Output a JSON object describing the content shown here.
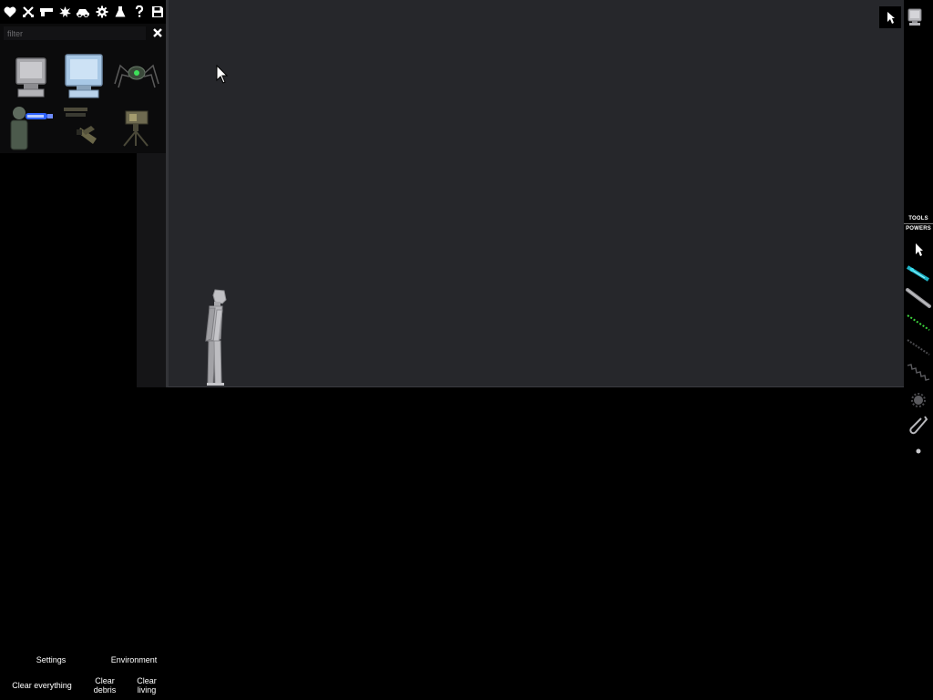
{
  "left_panel": {
    "category_icons": [
      "heart-icon",
      "crossed-swords-icon",
      "gun-icon",
      "explosion-icon",
      "vehicle-icon",
      "gear-icon",
      "flask-icon",
      "question-icon",
      "save-icon"
    ],
    "filter": {
      "placeholder": "filter",
      "value": ""
    },
    "items": [
      "grey-monitor-item",
      "blue-monitor-item",
      "spider-machine-item",
      "plasma-turret-item",
      "folded-machine-item",
      "tripod-camera-item"
    ]
  },
  "bottom_menu": {
    "settings": "Settings",
    "environment": "Environment",
    "clear_everything": "Clear everything",
    "clear_debris": "Clear\ndebris",
    "clear_living": "Clear\nliving"
  },
  "right_toolbar": {
    "tabs": {
      "tools": "TOOLS",
      "powers": "POWERS"
    },
    "tools": [
      "cursor-tool",
      "syringe-tool",
      "rod-tool",
      "green-wire-tool",
      "rope-tool",
      "spring-tool",
      "gear-pin-tool",
      "hook-tool",
      "point-tool"
    ]
  },
  "top_right": {
    "buttons": [
      "cursor-mode-button",
      "monitor-view-button"
    ]
  },
  "colors": {
    "world_background": "#26272b",
    "panel_background": "#0b0b0c",
    "ragdoll": "#b8b8bd",
    "accent_blue": "#3b6cff",
    "accent_green": "#3ed63e",
    "accent_teal": "#1fb3c6"
  }
}
